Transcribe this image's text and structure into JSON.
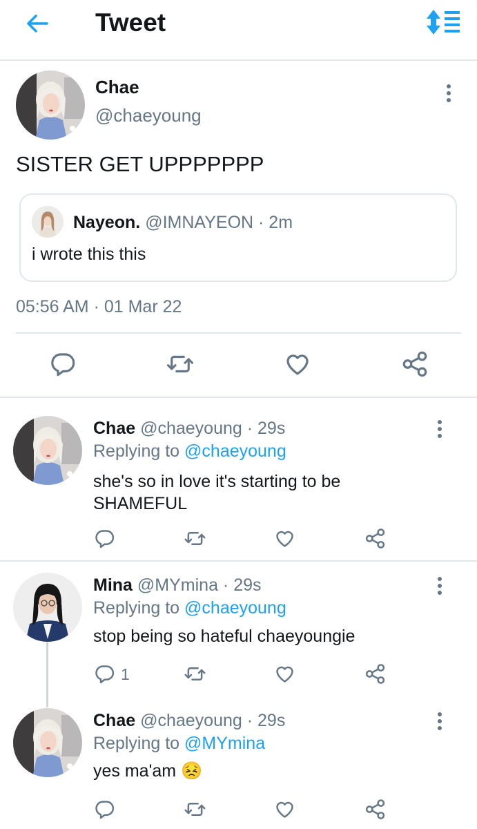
{
  "header": {
    "title": "Tweet"
  },
  "main_tweet": {
    "name": "Chae",
    "handle": "@chaeyoung",
    "text": "SISTER GET UPPPPPPP",
    "quote": {
      "name": "Nayeon.",
      "meta": "@IMNAYEON · 2m",
      "text": "i wrote this this"
    },
    "timestamp": "05:56 AM · 01 Mar 22"
  },
  "replies": [
    {
      "name": "Chae",
      "meta": "@chaeyoung · 29s",
      "replying_prefix": "Replying to ",
      "replying_to": "@chaeyoung",
      "text_lines": [
        "she's so in love it's starting to be",
        "SHAMEFUL"
      ]
    },
    {
      "name": "Mina",
      "meta": "@MYmina · 29s",
      "replying_prefix": "Replying to ",
      "replying_to": "@chaeyoung",
      "text": "stop being so hateful chaeyoungie",
      "reply_count": "1"
    },
    {
      "name": "Chae",
      "meta": "@chaeyoung · 29s",
      "replying_prefix": "Replying to ",
      "replying_to": "@MYmina",
      "text": "yes ma'am",
      "emoji": "😣"
    }
  ],
  "colors": {
    "accent": "#1da1f2",
    "muted": "#657786",
    "border": "#e1e8ed"
  },
  "icons": [
    "back-arrow-icon",
    "sort-icon",
    "more-icon",
    "reply-icon",
    "retweet-icon",
    "like-icon",
    "share-icon"
  ]
}
